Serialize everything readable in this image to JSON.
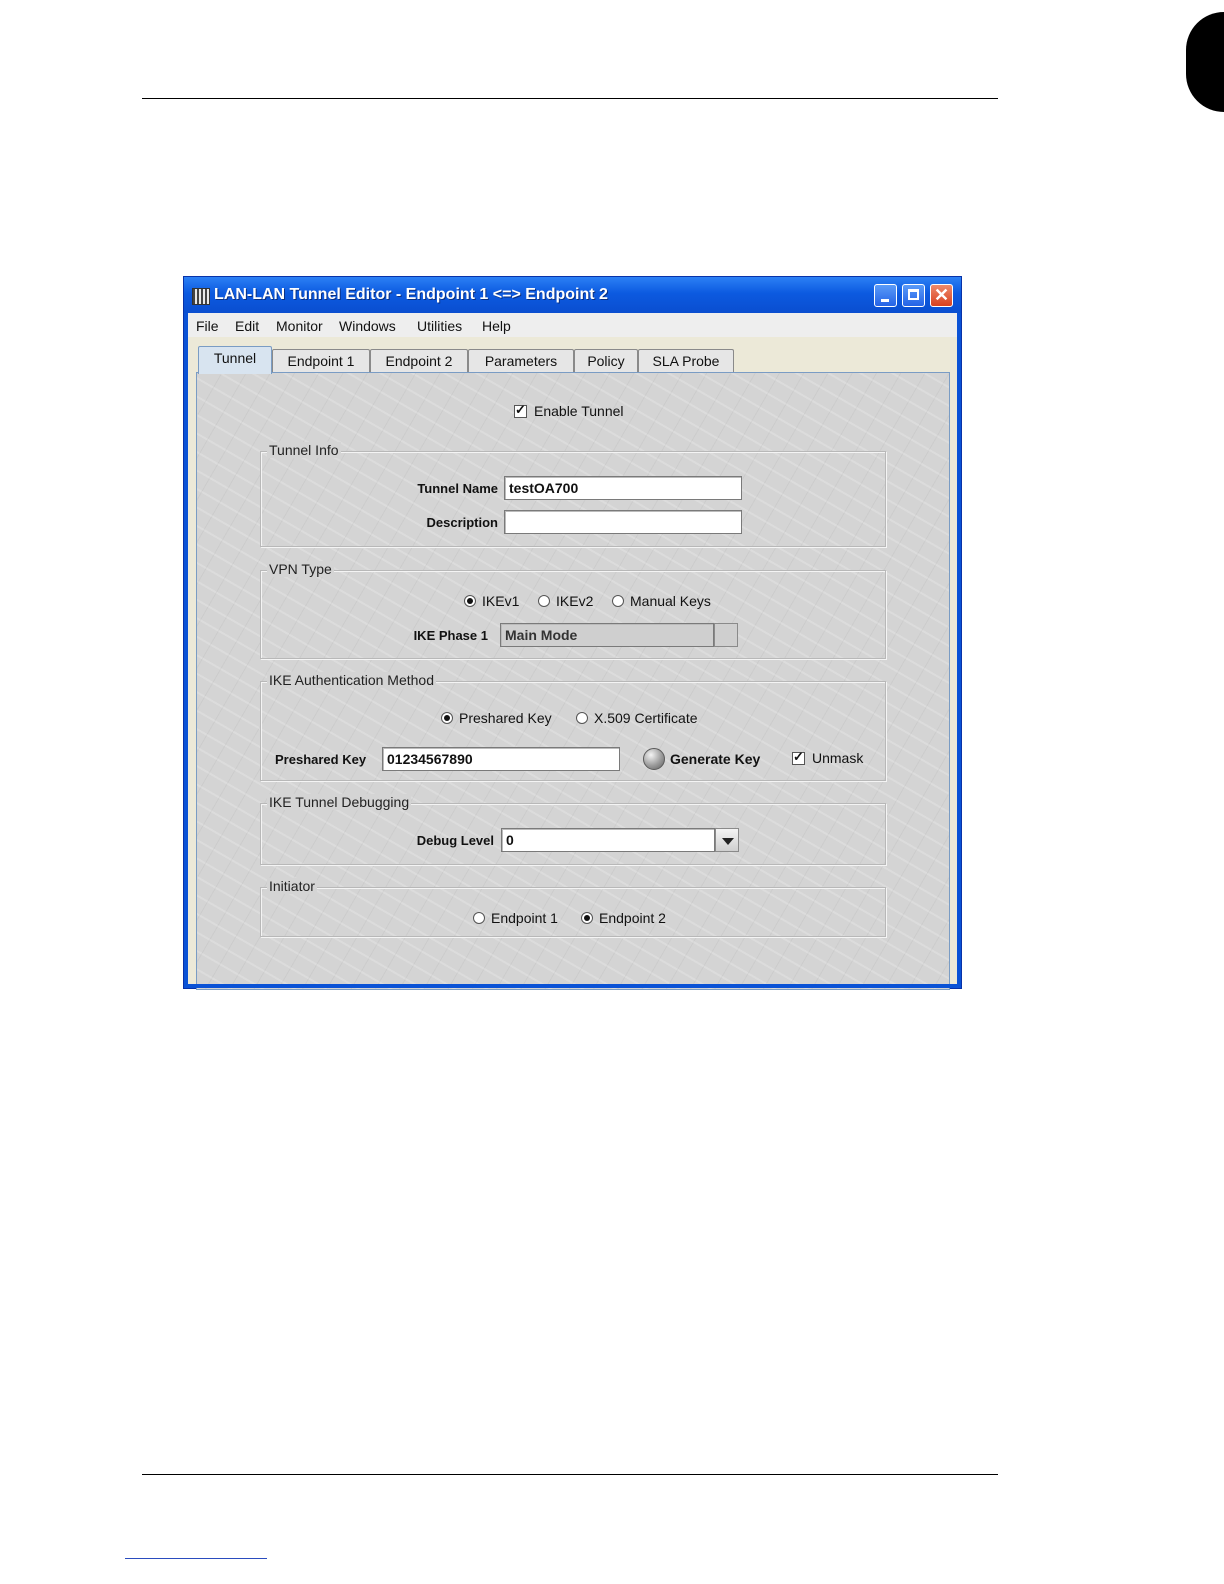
{
  "window": {
    "title": "LAN-LAN Tunnel Editor - Endpoint 1 <=> Endpoint 2"
  },
  "menu": [
    "File",
    "Edit",
    "Monitor",
    "Windows",
    "Utilities",
    "Help"
  ],
  "tabs": [
    {
      "label": "Tunnel",
      "active": true
    },
    {
      "label": "Endpoint 1",
      "active": false
    },
    {
      "label": "Endpoint 2",
      "active": false
    },
    {
      "label": "Parameters",
      "active": false
    },
    {
      "label": "Policy",
      "active": false
    },
    {
      "label": "SLA Probe",
      "active": false
    }
  ],
  "enable_tunnel": {
    "label": "Enable Tunnel",
    "checked": true
  },
  "tunnel_info": {
    "title": "Tunnel Info",
    "name_label": "Tunnel Name",
    "name_value": "testOA700",
    "description_label": "Description",
    "description_value": ""
  },
  "vpn_type": {
    "title": "VPN Type",
    "options": [
      {
        "label": "IKEv1",
        "selected": true
      },
      {
        "label": "IKEv2",
        "selected": false
      },
      {
        "label": "Manual Keys",
        "selected": false
      }
    ],
    "phase1_label": "IKE Phase 1",
    "phase1_value": "Main Mode"
  },
  "ike_auth": {
    "title": "IKE Authentication Method",
    "options": [
      {
        "label": "Preshared Key",
        "selected": true
      },
      {
        "label": "X.509 Certificate",
        "selected": false
      }
    ],
    "psk_label": "Preshared Key",
    "psk_value": "01234567890",
    "generate_label": "Generate Key",
    "unmask_label": "Unmask",
    "unmask_checked": true
  },
  "debugging": {
    "title": "IKE Tunnel Debugging",
    "level_label": "Debug Level",
    "level_value": "0"
  },
  "initiator": {
    "title": "Initiator",
    "options": [
      {
        "label": "Endpoint 1",
        "selected": false
      },
      {
        "label": "Endpoint 2",
        "selected": true
      }
    ]
  },
  "colors": {
    "titlebar": "#0a52d6",
    "panel": "#d4d4d4",
    "active_tab": "#d8e4f0"
  }
}
